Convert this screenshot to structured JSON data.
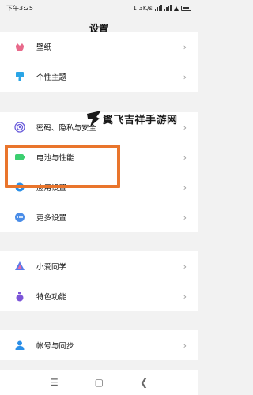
{
  "status": {
    "time": "下午3:25",
    "network_speed": "1.3K/s",
    "battery_icon": "battery-icon"
  },
  "header": {
    "title": "设置"
  },
  "groups": [
    {
      "items": [
        {
          "label": "壁纸",
          "icon": "wallpaper-flower-icon",
          "color": "#e86a8b"
        },
        {
          "label": "个性主题",
          "icon": "paintbrush-icon",
          "color": "#2aa5e6"
        }
      ]
    },
    {
      "items": [
        {
          "label": "密码、隐私与安全",
          "icon": "fingerprint-icon",
          "color": "#6b5ddb"
        },
        {
          "label": "电池与性能",
          "icon": "battery-icon",
          "color": "#3ccf70"
        },
        {
          "label": "应用设置",
          "icon": "gear-icon",
          "color": "#2a8fe8"
        },
        {
          "label": "更多设置",
          "icon": "more-dots-icon",
          "color": "#4a8de8"
        }
      ]
    },
    {
      "items": [
        {
          "label": "小爱同学",
          "icon": "xiaoai-icon",
          "color": "#5a7be8"
        },
        {
          "label": "特色功能",
          "icon": "flask-icon",
          "color": "#7c55d8"
        }
      ]
    },
    {
      "items": [
        {
          "label": "帐号与同步",
          "icon": "account-icon",
          "color": "#2a8fe8"
        }
      ]
    }
  ],
  "watermark": {
    "text": "翼飞吉祥手游网"
  },
  "nav": {
    "menu_icon": "menu-icon",
    "home_icon": "home-icon",
    "back_icon": "back-icon"
  },
  "colors": {
    "highlight": "#e9752c",
    "background": "#f2f2f2"
  }
}
